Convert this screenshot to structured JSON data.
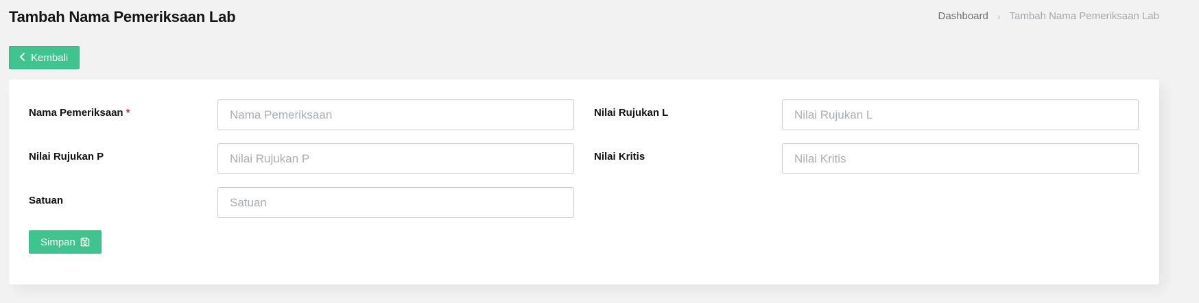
{
  "page": {
    "title": "Tambah Nama Pemeriksaan Lab"
  },
  "breadcrumb": {
    "home": "Dashboard",
    "separator": "›",
    "current": "Tambah Nama Pemeriksaan Lab"
  },
  "back_button": {
    "icon": "chevron-left-icon",
    "label": "Kembali"
  },
  "form": {
    "nama_pemeriksaan": {
      "label": "Nama Pemeriksaan",
      "required_marker": "*",
      "placeholder": "Nama Pemeriksaan",
      "value": ""
    },
    "nilai_rujukan_l": {
      "label": "Nilai Rujukan L",
      "placeholder": "Nilai Rujukan L",
      "value": ""
    },
    "nilai_rujukan_p": {
      "label": "Nilai Rujukan P",
      "placeholder": "Nilai Rujukan P",
      "value": ""
    },
    "nilai_kritis": {
      "label": "Nilai Kritis",
      "placeholder": "Nilai Kritis",
      "value": ""
    },
    "satuan": {
      "label": "Satuan",
      "placeholder": "Satuan",
      "value": ""
    }
  },
  "save_button": {
    "label": "Simpan",
    "icon": "floppy-disk-icon"
  },
  "colors": {
    "accent": "#3fc38f",
    "required": "#e02424",
    "background": "#f2f2f2"
  }
}
